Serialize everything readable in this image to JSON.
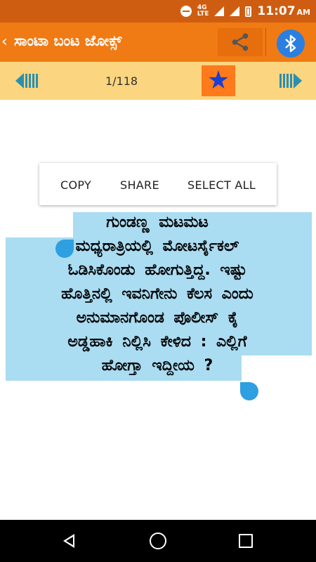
{
  "status_bar": {
    "network_label": "4G",
    "lte_label": "LTE",
    "time": "11:07",
    "ampm": "AM"
  },
  "app_bar": {
    "back_icon": "chevron-left-icon",
    "title": "ಸಾಂಟಾ ಬಂಟ ಜೋಕ್ಸ್",
    "share_icon": "share-icon",
    "bluetooth_icon": "bluetooth-icon"
  },
  "pager": {
    "counter": "1/118",
    "prev_icon": "prev-arrow-icon",
    "next_icon": "next-arrow-icon",
    "favorite_icon": "star-icon"
  },
  "text_actions": {
    "copy": "COPY",
    "share": "SHARE",
    "select_all": "SELECT ALL"
  },
  "joke": {
    "lines": [
      "ಗುಂಡಣ್ಣ ಮಟಮಟ",
      "ಮಧ್ಯರಾತ್ರಿಯಲ್ಲಿ ಮೋಟರ್ಸೈಕಲ್",
      "ಓಡಿಸಿಕೊಂಡು ಹೋಗುತ್ತಿದ್ದ. ಇಷ್ಟು",
      "ಹೊತ್ತಿನಲ್ಲಿ ಇವನಿಗೇನು ಕೆಲಸ ಎಂದು",
      "ಅನುಮಾನಗೊಂಡ ಪೊಲೀಸ್ ಕೈ",
      "ಅಡ್ಡಹಾಕಿ ನಿಲ್ಲಿಸಿ ಕೇಳಿದ : ಎಲ್ಲಿಗೆ",
      "ಹೋಗ್ತಾ ಇದ್ದೀಯ ?"
    ]
  },
  "colors": {
    "status_bar": "#cf5d11",
    "app_bar": "#f07a14",
    "pager_bar": "#fbd57f",
    "favorite_bg": "#ff7a1a",
    "selection": "#aadcf2",
    "handle": "#2e9fe0"
  },
  "system_nav": {
    "back_icon": "back-triangle-icon",
    "home_icon": "home-circle-icon",
    "recents_icon": "recents-square-icon"
  }
}
